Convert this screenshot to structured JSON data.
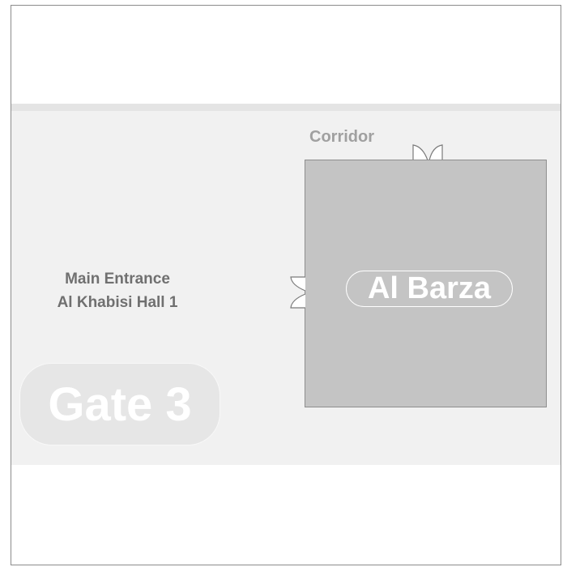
{
  "map": {
    "corridor_label": "Corridor",
    "room_name": "Al Barza",
    "entrance_line1": "Main Entrance",
    "entrance_line2": "Al Khabisi Hall 1",
    "gate_label": "Gate 3"
  },
  "colors": {
    "background": "#ffffff",
    "zone": "#f1f1f1",
    "room": "#c4c4c4",
    "label_gray": "#707070"
  },
  "icons": [
    "door-top-icon",
    "door-left-icon"
  ]
}
